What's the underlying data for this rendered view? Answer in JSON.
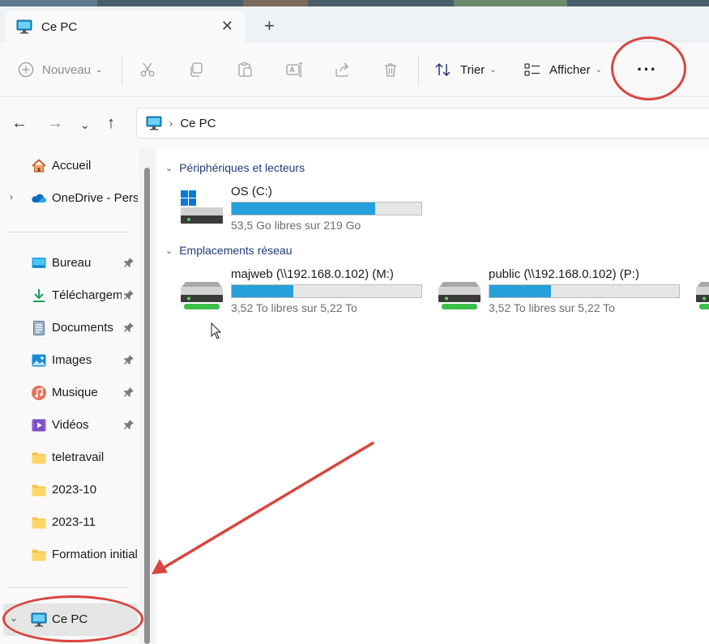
{
  "window": {
    "tab_title": "Ce PC",
    "new_tab_symbol": "+",
    "close_symbol": "✕"
  },
  "toolbar": {
    "new_label": "Nouveau",
    "sort_label": "Trier",
    "view_label": "Afficher",
    "more_symbol": "···"
  },
  "address": {
    "path_text": "Ce PC"
  },
  "sidebar": {
    "items": [
      {
        "label": "Accueil",
        "icon": "home-icon"
      },
      {
        "label": "OneDrive - Personnel",
        "icon": "onedrive-icon"
      },
      {
        "label": "Bureau",
        "icon": "desktop-folder-icon",
        "pinned": true
      },
      {
        "label": "Téléchargements",
        "icon": "download-icon",
        "pinned": true
      },
      {
        "label": "Documents",
        "icon": "documents-icon",
        "pinned": true
      },
      {
        "label": "Images",
        "icon": "images-icon",
        "pinned": true
      },
      {
        "label": "Musique",
        "icon": "music-icon",
        "pinned": true
      },
      {
        "label": "Vidéos",
        "icon": "videos-icon",
        "pinned": true
      },
      {
        "label": "teletravail",
        "icon": "folder-icon"
      },
      {
        "label": "2023-10",
        "icon": "folder-icon"
      },
      {
        "label": "2023-11",
        "icon": "folder-icon"
      },
      {
        "label": "Formation initiale",
        "icon": "folder-icon"
      },
      {
        "label": "Ce PC",
        "icon": "this-pc-icon",
        "selected": true
      }
    ]
  },
  "main": {
    "groups": [
      {
        "title": "Périphériques et lecteurs",
        "drives": [
          {
            "name": "OS (C:)",
            "free_text": "53,5 Go libres sur 219 Go",
            "used_fraction": 0.756
          }
        ]
      },
      {
        "title": "Emplacements réseau",
        "drives": [
          {
            "name": "majweb (\\\\192.168.0.102) (M:)",
            "free_text": "3,52 To libres sur 5,22 To",
            "used_fraction": 0.326
          },
          {
            "name": "public (\\\\192.168.0.102) (P:)",
            "free_text": "3,52 To libres sur 5,22 To",
            "used_fraction": 0.326
          }
        ]
      }
    ]
  },
  "colors": {
    "accent": "#26a0da",
    "annotation": "#d9453f",
    "link_blue": "#1f3a7a"
  }
}
